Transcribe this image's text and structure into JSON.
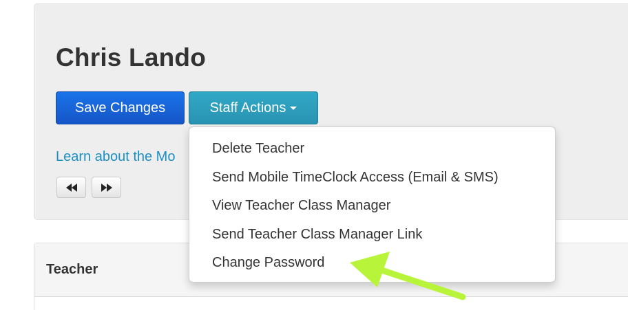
{
  "profile": {
    "name": "Chris Lando"
  },
  "toolbar": {
    "save_label": "Save Changes",
    "staff_actions_label": "Staff Actions"
  },
  "learn_link": "Learn about the Mo",
  "nav": {
    "prev_glyph": "◀◀",
    "next_glyph": "▶▶"
  },
  "staff_menu": {
    "items": [
      {
        "label": "Delete Teacher"
      },
      {
        "label": "Send Mobile TimeClock Access (Email & SMS)"
      },
      {
        "label": "View Teacher Class Manager"
      },
      {
        "label": "Send Teacher Class Manager Link"
      },
      {
        "label": "Change Password"
      }
    ]
  },
  "panel": {
    "title": "Teacher"
  },
  "colors": {
    "save_button": "#1a73e8",
    "staff_button": "#31a8c6",
    "link": "#1b8fc2",
    "annotation_arrow": "#b8f53a"
  },
  "icons": {
    "caret": "caret-down-icon",
    "prev": "rewind-icon",
    "next": "fast-forward-icon",
    "annotation": "annotation-arrow-icon"
  }
}
